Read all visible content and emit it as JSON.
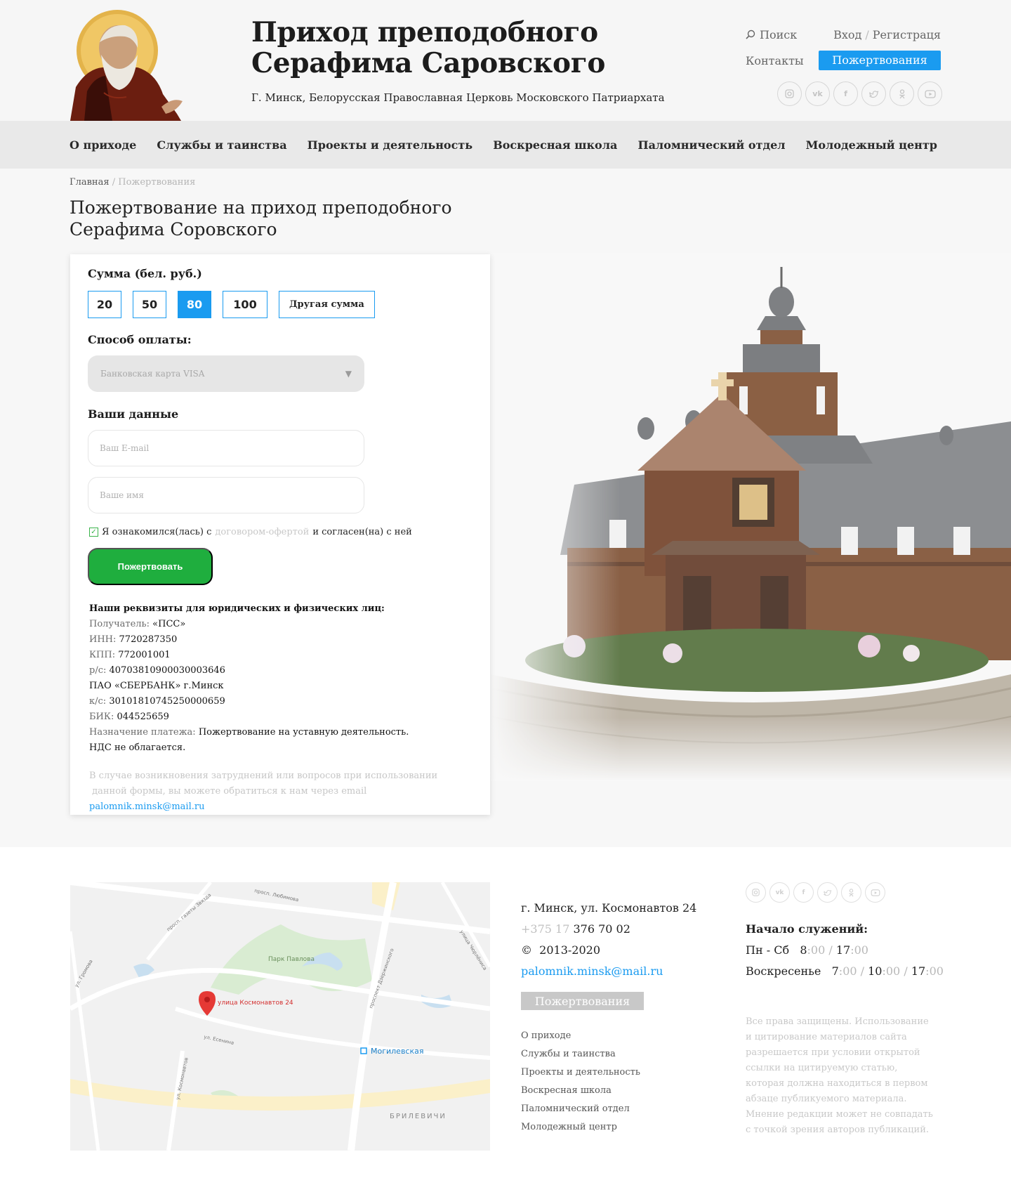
{
  "header": {
    "title_line1": "Приход преподобного",
    "title_line2": "Серафима Саровского",
    "subtitle": "Г. Минск, Белорусская Православная Церковь Московского Патриархата",
    "search_label": "Поиск",
    "login_label": "Вход",
    "login_sep": "/",
    "register_label": "Регистраця",
    "contacts_label": "Контакты",
    "donate_label": "Пожертвования",
    "socials": [
      "instagram-icon",
      "vk-icon",
      "facebook-icon",
      "twitter-icon",
      "odnoklassniki-icon",
      "youtube-icon"
    ]
  },
  "nav": {
    "items": [
      "О приходе",
      "Службы и таинства",
      "Проекты и деятельность",
      "Воскресная школа",
      "Паломнический отдел",
      "Молодежный центр"
    ]
  },
  "breadcrumb": {
    "home": "Главная",
    "sep": "/",
    "current": "Пожертвования"
  },
  "page": {
    "title_line1": "Пожертвование на приход преподобного",
    "title_line2": "Серафима Соровского"
  },
  "form": {
    "amount_label": "Сумма (бел. руб.)",
    "amounts": [
      "20",
      "50",
      "80",
      "100"
    ],
    "selected_amount": "80",
    "other_amount_label": "Другая сумма",
    "payment_label": "Способ оплаты:",
    "payment_value": "Банковская карта VISA",
    "your_data_label": "Ваши данные",
    "email_placeholder": "Ваш E-mail",
    "name_placeholder": "Ваше имя",
    "agree_prefix": "Я ознакомился(лась) с",
    "agree_link": "договором-офертой",
    "agree_suffix": "и согласен(на) с ней",
    "agree_checked": true,
    "submit_label": "Пожертвовать"
  },
  "requisites": {
    "title": "Наши реквизиты для юридических и физических лиц:",
    "recipient_key": "Получатель:",
    "recipient_val": "«ПСС»",
    "inn_key": "ИНН:",
    "inn_val": "7720287350",
    "kpp_key": "КПП:",
    "kpp_val": "772001001",
    "rs_key": "р/с:",
    "rs_val": "40703810900030003646",
    "bank": "ПАО «СБЕРБАНК» г.Минск",
    "ks_key": "к/с:",
    "ks_val": "30101810745250000659",
    "bik_key": "БИК:",
    "bik_val": "044525659",
    "purpose_key": "Назначение платежа:",
    "purpose_val": "Пожертвование на уставную деятельность.",
    "vat": "НДС не облагается."
  },
  "note": {
    "text1": "В случае возникновения затруднений или вопросов при использовании",
    "text2": "данной формы, вы можете обратиться к нам через email",
    "email": "palomnik.minsk@mail.ru"
  },
  "map": {
    "marker_label": "улица Космонавтов 24",
    "park_label": "Парк Павлова",
    "metro_label": "Могилевская",
    "district_label": "БРИЛЕВИЧИ",
    "streets": [
      "просп. Любимова",
      "просп. газеты Звязда",
      "ул. Есенина",
      "ул. Громова",
      "ул. Космонавтов",
      "проспект Дзержинского",
      "улица Чюрлёниса"
    ]
  },
  "footer": {
    "address": "г. Минск, ул. Космонавтов 24",
    "phone_code": "+375 17",
    "phone_num": "376 70 02",
    "copyright_sign": "©",
    "years": "2013-2020",
    "email": "palomnik.minsk@mail.ru",
    "donate_label": "Пожертвования",
    "links": [
      "О приходе",
      "Службы и таинства",
      "Проекты и деятельность",
      "Воскресная школа",
      "Паломнический отдел",
      "Молодежный центр"
    ],
    "schedule_title": "Начало служений:",
    "weekdays_label": "Пн - Сб",
    "weekdays_times": [
      {
        "h": "8",
        "m": ":00"
      },
      {
        "h": "17",
        "m": ":00"
      }
    ],
    "sunday_label": "Воскресенье",
    "sunday_times": [
      {
        "h": "7",
        "m": ":00"
      },
      {
        "h": "10",
        "m": ":00"
      },
      {
        "h": "17",
        "m": ":00"
      }
    ],
    "copyright_text": "Все права защищены. Использование и цитирование материалов сайта разрешается при условии открытой ссылки на цитируемую статью, которая должна находиться в первом абзаце публикуемого материала. Мнение редакции может не совпадать с точкой зрения авторов публикаций."
  }
}
